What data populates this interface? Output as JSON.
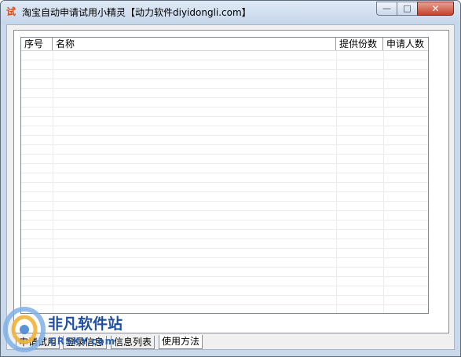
{
  "window": {
    "title": "淘宝自动申请试用小精灵【动力软件diyidongli.com】",
    "icon_glyph": "试",
    "icon": "app-trial-icon",
    "controls": {
      "minimize_glyph": "—",
      "maximize_glyph": "□",
      "close_glyph": "✕"
    }
  },
  "list": {
    "columns": [
      "序号",
      "名称",
      "提供份数",
      "申请人数"
    ],
    "rows": []
  },
  "tabs": [
    {
      "label": "申请试用",
      "active": false
    },
    {
      "label": "登录信息",
      "active": false
    },
    {
      "label": "信息列表",
      "active": false
    },
    {
      "label": "使用方法",
      "active": true
    }
  ],
  "watermark": {
    "text": "非凡软件站",
    "subtext": "CRSKY.com",
    "logo": "crsky-logo-icon"
  },
  "colors": {
    "title_bar": "#c5d6ea",
    "close_button": "#c7422d",
    "client_background": "#f0f0f0"
  }
}
